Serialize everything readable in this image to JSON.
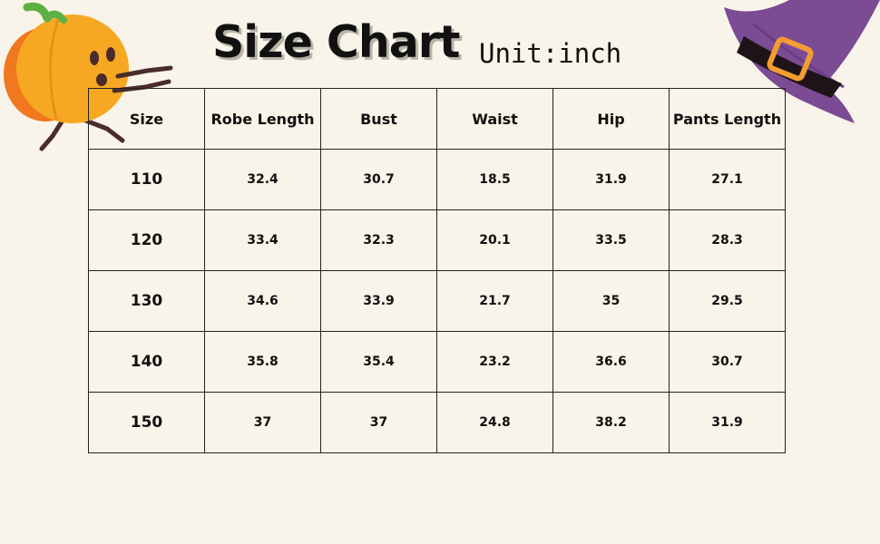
{
  "header": {
    "title": "Size Chart",
    "unit": "Unit:inch"
  },
  "table": {
    "columns": [
      "Size",
      "Robe Length",
      "Bust",
      "Waist",
      "Hip",
      "Pants Length"
    ],
    "rows": [
      [
        "110",
        "32.4",
        "30.7",
        "18.5",
        "31.9",
        "27.1"
      ],
      [
        "120",
        "33.4",
        "32.3",
        "20.1",
        "33.5",
        "28.3"
      ],
      [
        "130",
        "34.6",
        "33.9",
        "21.7",
        "35",
        "29.5"
      ],
      [
        "140",
        "35.8",
        "35.4",
        "23.2",
        "36.6",
        "30.7"
      ],
      [
        "150",
        "37",
        "37",
        "24.8",
        "38.2",
        "31.9"
      ]
    ]
  },
  "colors": {
    "background": "#f9f4e9",
    "pumpkin": "#f5a623",
    "hat": "#7b4b94",
    "buckle": "#f39c33"
  },
  "decorations": [
    "pumpkin-character-icon",
    "witch-hat-icon"
  ]
}
